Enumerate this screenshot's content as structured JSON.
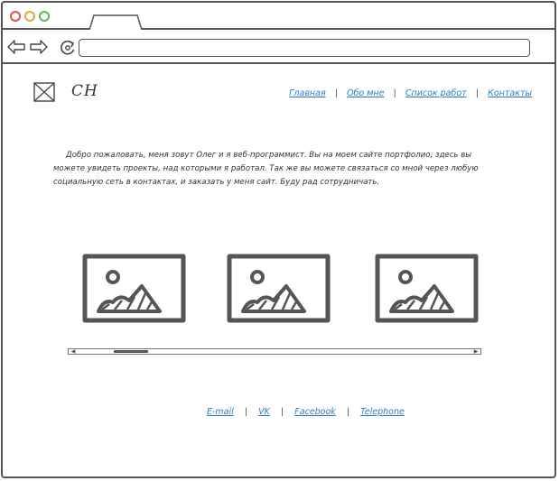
{
  "browser": {
    "url": ""
  },
  "header": {
    "logo_text": "CH",
    "nav": [
      {
        "label": "Главная"
      },
      {
        "label": "Обо мне"
      },
      {
        "label": "Список работ"
      },
      {
        "label": "Контакты"
      }
    ]
  },
  "intro": {
    "text": "Добро пожаловать, меня зовут Олег и я веб-программист. Вы на моем сайте портфолио, здесь вы можете увидеть проекты, над которыми я работал. Так же вы можете связаться со мной через любую социальную сеть в контактах, и заказать у меня сайт. Буду рад сотрудничать."
  },
  "gallery": {
    "item_count": 3,
    "scroll_position": 0.1
  },
  "footer": {
    "links": [
      {
        "label": "E-mail"
      },
      {
        "label": "VK"
      },
      {
        "label": "Facebook"
      },
      {
        "label": "Telephone"
      }
    ]
  },
  "colors": {
    "link": "#2b7cc6",
    "stroke": "#555555",
    "close_dot": "#d9534f",
    "minimize_dot": "#e8a33d",
    "maximize_dot": "#5cb85c"
  }
}
